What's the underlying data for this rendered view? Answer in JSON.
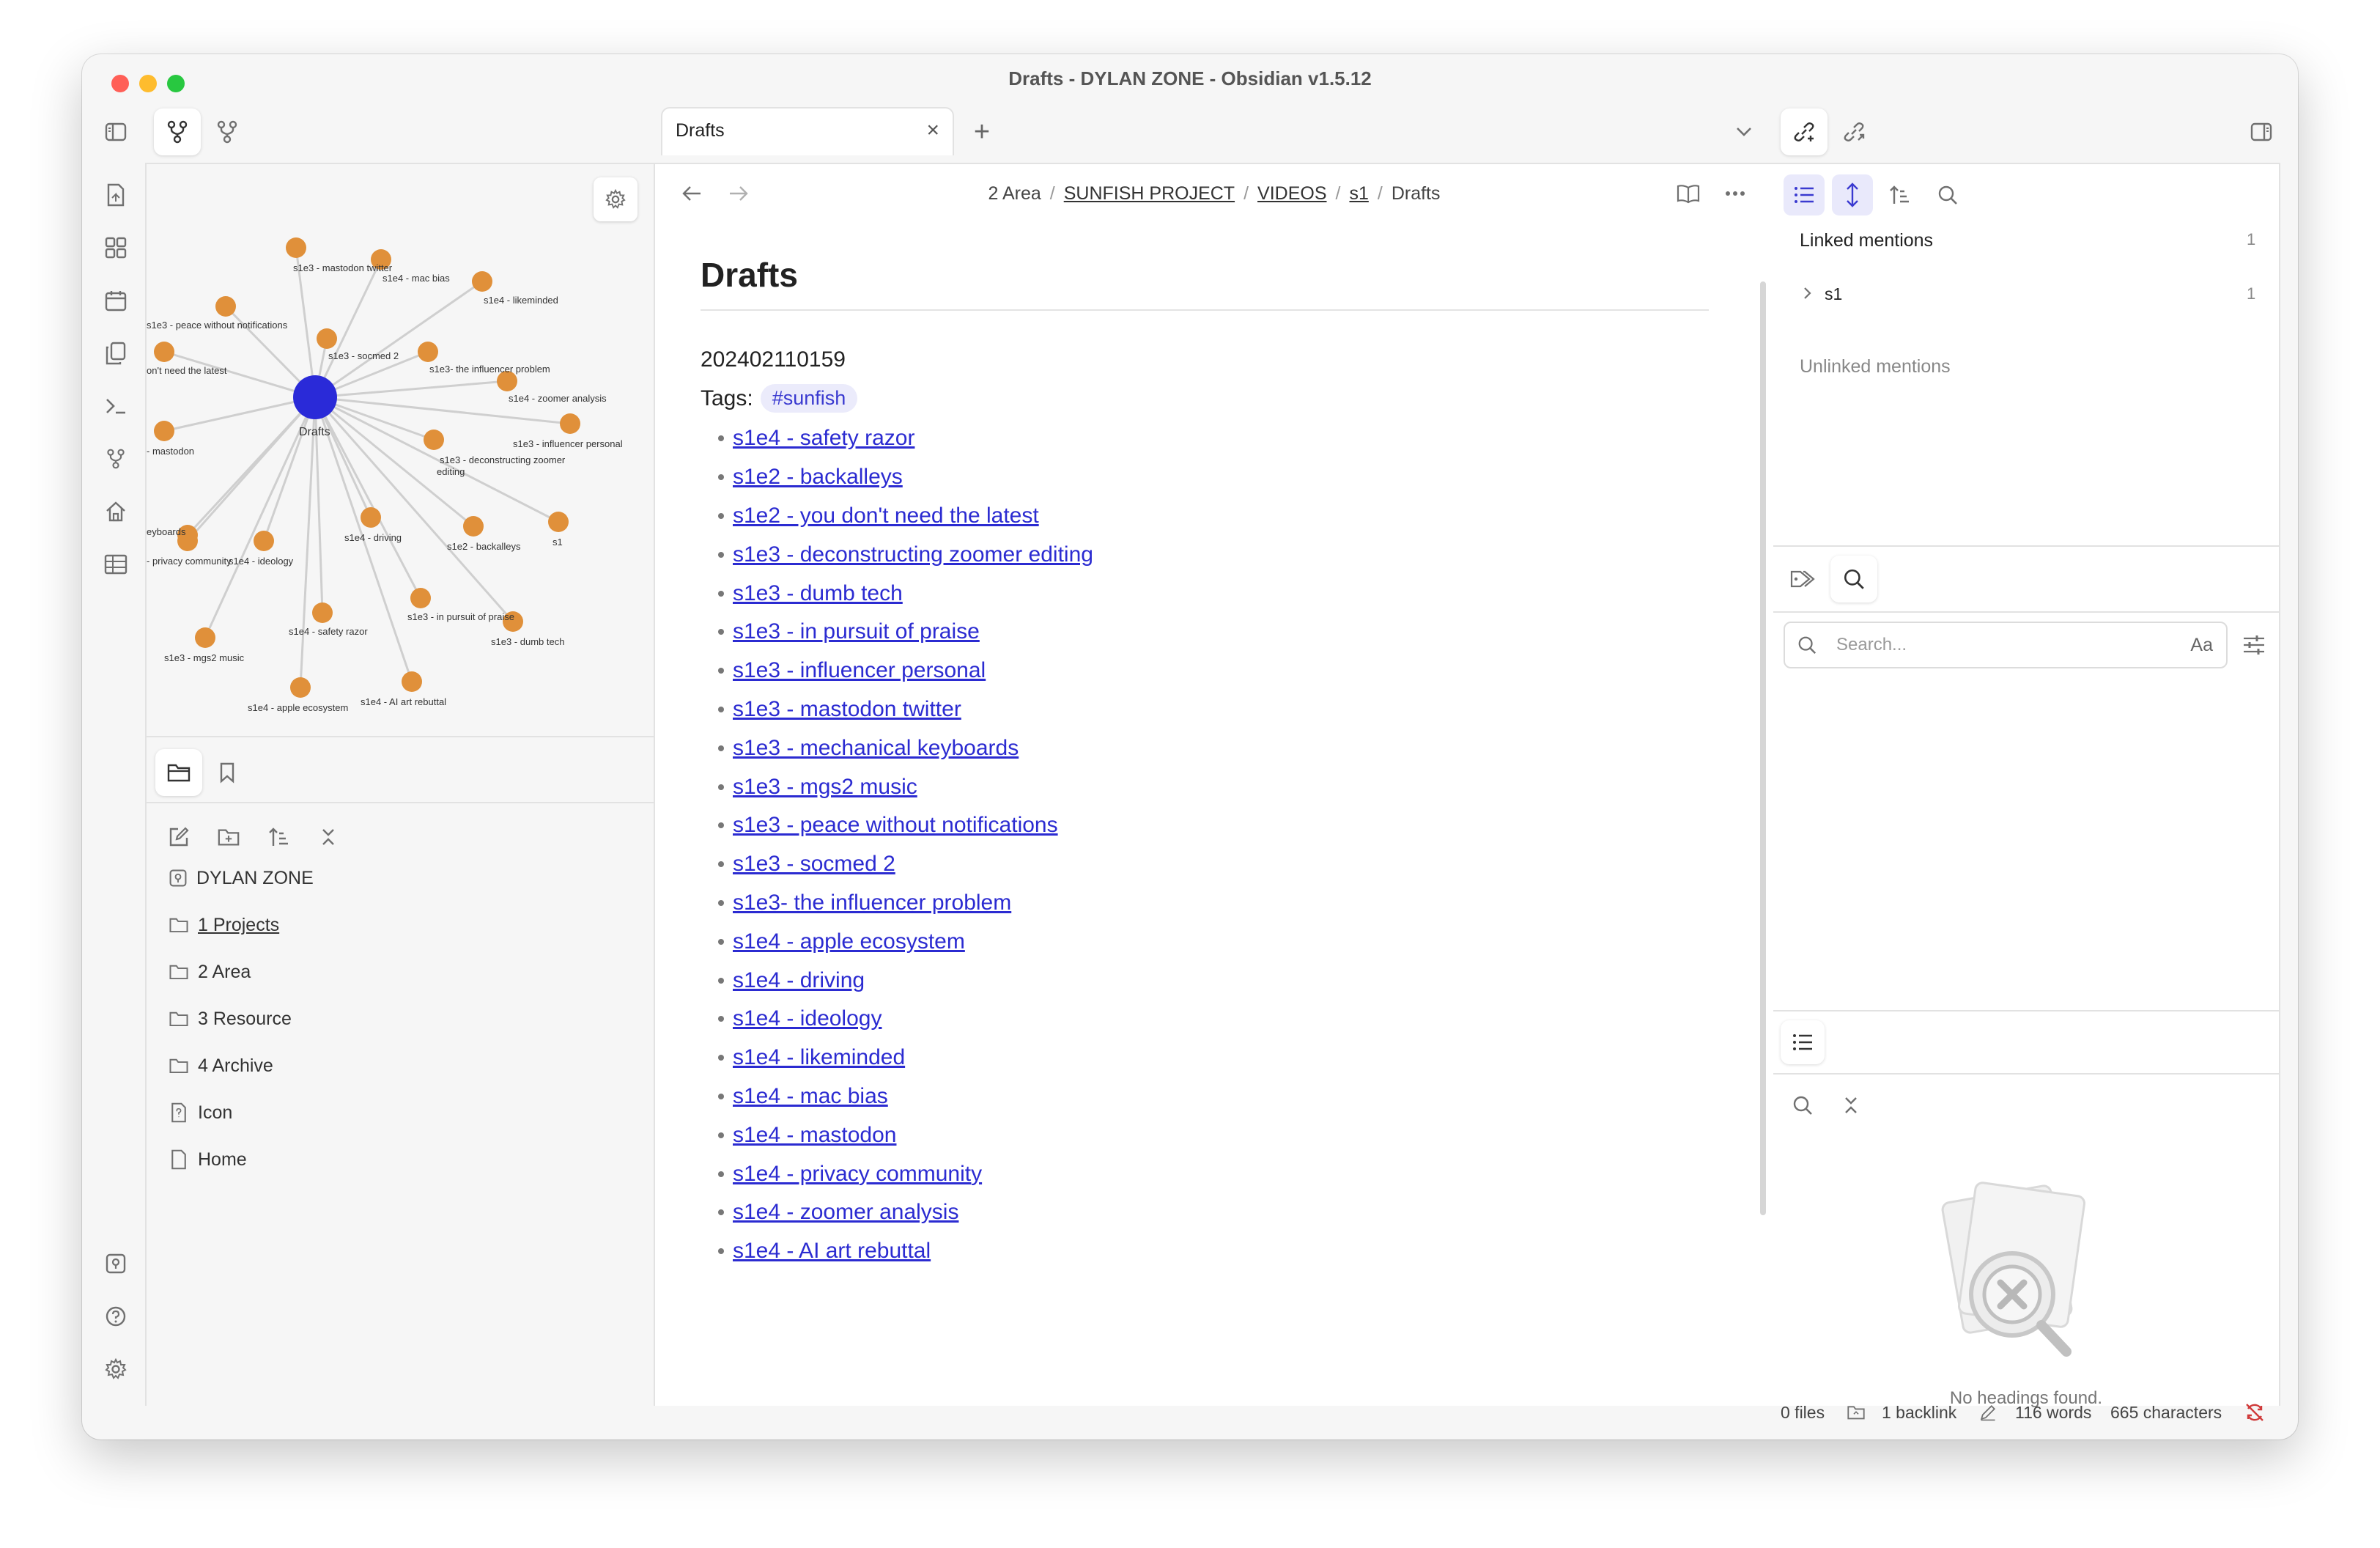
{
  "window": {
    "title": "Drafts - DYLAN ZONE - Obsidian v1.5.12"
  },
  "tab": {
    "title": "Drafts",
    "close": "×",
    "new": "+"
  },
  "breadcrumb": [
    "2 Area",
    "SUNFISH PROJECT",
    "VIDEOS",
    "s1",
    "Drafts"
  ],
  "note": {
    "title": "Drafts",
    "id": "202402110159",
    "tags_label": "Tags:",
    "tag": "#sunfish",
    "links": [
      "s1e4 - safety razor",
      "s1e2 - backalleys",
      "s1e2 - you don't need the latest",
      "s1e3 - deconstructing zoomer editing",
      "s1e3 - dumb tech",
      "s1e3 - in pursuit of praise",
      "s1e3 - influencer personal",
      "s1e3 - mastodon twitter",
      "s1e3 - mechanical keyboards",
      "s1e3 - mgs2 music",
      "s1e3 - peace without notifications",
      "s1e3 - socmed 2",
      "s1e3- the influencer problem",
      "s1e4 - apple ecosystem",
      "s1e4 - driving",
      "s1e4 - ideology",
      "s1e4 - likeminded",
      "s1e4 - mac bias",
      "s1e4 - mastodon",
      "s1e4 - privacy community",
      "s1e4 - zoomer analysis",
      "s1e4 - AI art rebuttal"
    ]
  },
  "graph": {
    "center": "Drafts",
    "nodes": [
      "s1e3 - mastodon twitter",
      "s1e4 - mac bias",
      "s1e4 - likeminded",
      "s1e3 - peace without notifications",
      "s1e3 - socmed 2",
      "s1e3- the influencer problem",
      "on't need the latest",
      "s1e4 - zoomer analysis",
      "s1e3 - influencer personal",
      "- mastodon",
      "s1e3 - deconstructing zoomer",
      "editing",
      "eyboards",
      "s1e4 - driving",
      "s1e2 - backalleys",
      "s1",
      "- privacy community",
      "s1e4 - ideology",
      "s1e3 - in pursuit of praise",
      "s1e4 - safety razor",
      "s1e3 - mgs2 music",
      "s1e3 - dumb tech",
      "s1e4 - apple ecosystem",
      "s1e4 - AI art rebuttal"
    ]
  },
  "file_tree": {
    "vault": "DYLAN ZONE",
    "items": [
      "1 Projects",
      "2 Area",
      "3 Resource",
      "4 Archive",
      "Icon",
      "Home"
    ]
  },
  "backlinks": {
    "linked_label": "Linked mentions",
    "linked_count": "1",
    "item": "s1",
    "item_count": "1",
    "unlinked_label": "Unlinked mentions"
  },
  "search": {
    "placeholder": "Search...",
    "match_case": "Aa"
  },
  "outline": {
    "empty": "No headings found."
  },
  "status_bar": {
    "files": "0 files",
    "backlinks": "1 backlink",
    "words": "116 words",
    "characters": "665 characters"
  },
  "colors": {
    "accent": "#3a3ad0",
    "graph_center": "#2a2ad8",
    "graph_node": "#e0903a",
    "traffic_red": "#ff5f57",
    "traffic_yellow": "#febc2e",
    "traffic_green": "#28c840"
  }
}
